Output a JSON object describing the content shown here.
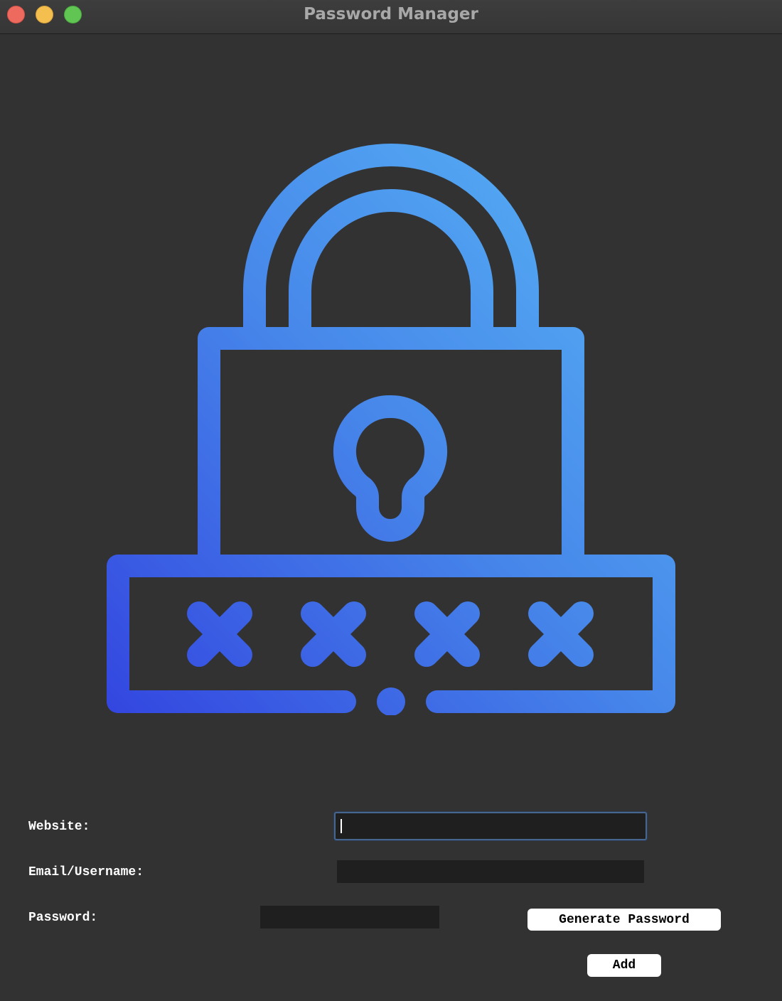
{
  "window": {
    "title": "Password Manager"
  },
  "icons": {
    "close": "close-button",
    "minimize": "minimize-button",
    "zoom": "zoom-button",
    "logo": "padlock-password-icon"
  },
  "colors": {
    "background": "#323232",
    "input_background": "#1f1f1f",
    "logo_gradient_start": "#3346e0",
    "logo_gradient_end": "#58b6f6",
    "focus_ring": "#46658f"
  },
  "form": {
    "website": {
      "label": "Website:",
      "value": ""
    },
    "email": {
      "label": "Email/Username:",
      "value": ""
    },
    "password": {
      "label": "Password:",
      "value": ""
    },
    "generate_button": "Generate Password",
    "add_button": "Add"
  }
}
